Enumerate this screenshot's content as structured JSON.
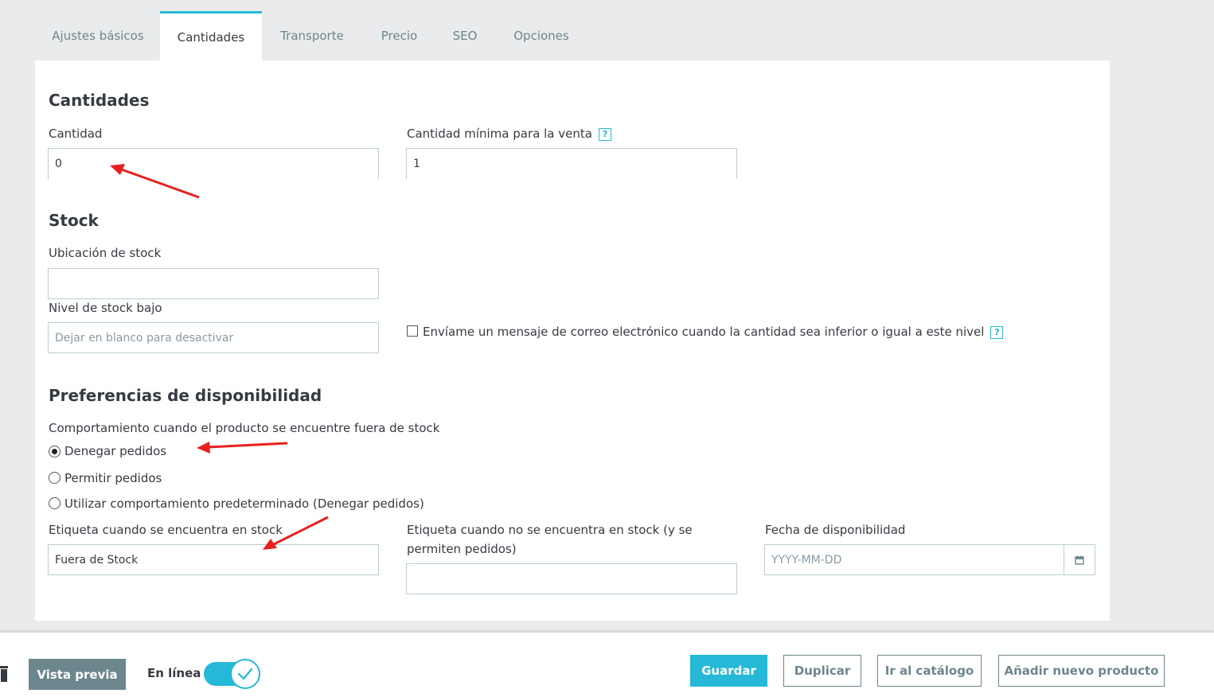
{
  "tabs": [
    {
      "label": "Ajustes básicos"
    },
    {
      "label": "Cantidades"
    },
    {
      "label": "Transporte"
    },
    {
      "label": "Precio"
    },
    {
      "label": "SEO"
    },
    {
      "label": "Opciones"
    }
  ],
  "quantities": {
    "title": "Cantidades",
    "quantity_label": "Cantidad",
    "quantity_value": "0",
    "min_qty_label": "Cantidad mínima para la venta",
    "min_qty_value": "1"
  },
  "stock": {
    "title": "Stock",
    "location_label": "Ubicación de stock",
    "location_value": "",
    "low_stock_label": "Nivel de stock bajo",
    "low_stock_placeholder": "Dejar en blanco para desactivar",
    "email_alert_label": "Envíame un mensaje de correo electrónico cuando la cantidad sea inferior o igual a este nivel"
  },
  "availability": {
    "title": "Preferencias de disponibilidad",
    "behavior_label": "Comportamiento cuando el producto se encuentre fuera de stock",
    "options": [
      {
        "label": "Denegar pedidos",
        "selected": true
      },
      {
        "label": "Permitir pedidos",
        "selected": false
      },
      {
        "label": "Utilizar comportamiento predeterminado (Denegar pedidos)",
        "selected": false
      }
    ],
    "in_stock_label": "Etiqueta cuando se encuentra en stock",
    "in_stock_value": "Fuera de Stock",
    "out_stock_label_line1": "Etiqueta cuando no se encuentra en stock (y se",
    "out_stock_label_line2": "permiten pedidos)",
    "out_stock_value": "",
    "date_label": "Fecha de disponibilidad",
    "date_placeholder": "YYYY-MM-DD"
  },
  "help_glyph": "?",
  "footer": {
    "preview_label": "Vista previa",
    "online_label": "En línea",
    "online_enabled": true,
    "save_label": "Guardar",
    "duplicate_label": "Duplicar",
    "catalog_label": "Ir al catálogo",
    "add_product_label": "Añadir nuevo producto"
  },
  "colors": {
    "accent": "#25b9d7",
    "annotation_arrow": "#e8201f",
    "secondary_button": "#6c868e",
    "background": "#eaebec"
  },
  "icons": [
    "help-icon",
    "calendar-icon",
    "trash-icon",
    "check-icon",
    "annotation-arrow"
  ]
}
